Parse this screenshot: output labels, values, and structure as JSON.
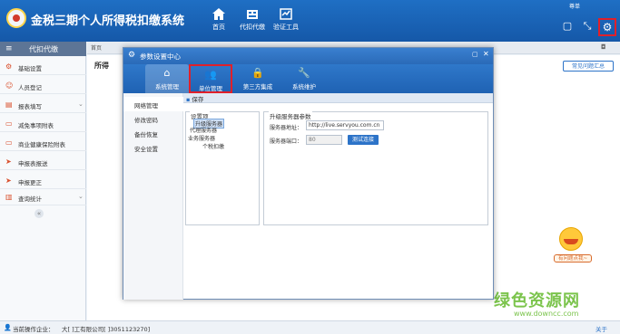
{
  "app": {
    "title": "金税三期个人所得税扣缴系统",
    "top_right_text": "尊单"
  },
  "nav": [
    {
      "label": "首页",
      "icon": "home-icon"
    },
    {
      "label": "代扣代缴",
      "icon": "briefcase-icon"
    },
    {
      "label": "验证工具",
      "icon": "tools-icon"
    }
  ],
  "sidebar": {
    "header": "代扣代缴",
    "items": [
      {
        "label": "基础设置",
        "icon": "gear-icon"
      },
      {
        "label": "人员登记",
        "icon": "person-icon"
      },
      {
        "label": "报表填写",
        "icon": "report-icon",
        "expandable": true
      },
      {
        "label": "减免事项附表",
        "icon": "document-icon"
      },
      {
        "label": "商业健康保险附表",
        "icon": "document-icon"
      },
      {
        "label": "申报表报送",
        "icon": "send-icon"
      },
      {
        "label": "申报更正",
        "icon": "send-icon"
      },
      {
        "label": "查询统计",
        "icon": "chart-icon",
        "expandable": true
      }
    ]
  },
  "main": {
    "tab_home": "首页",
    "page_title": "所得",
    "help_button": "常见问题汇总",
    "mascot_label": "有问题点我~"
  },
  "dialog": {
    "title": "参数设置中心",
    "tabs": [
      {
        "label": "系统管理",
        "icon": "house-icon"
      },
      {
        "label": "单位管理",
        "icon": "users-icon"
      },
      {
        "label": "第三方集成",
        "icon": "lock-icon"
      },
      {
        "label": "系统维护",
        "icon": "wrench-icon"
      }
    ],
    "left_nav": [
      "网络管理",
      "修改密码",
      "备份恢复",
      "安全设置"
    ],
    "save_label": "保存",
    "tree": {
      "legend": "设置项",
      "nodes": [
        "升级服务器",
        "代理服务器",
        "业务服务器",
        "个税扣缴"
      ]
    },
    "settings": {
      "legend": "升级服务器参数",
      "address_label": "服务器地址：",
      "address_value": "http://live.servyou.com.cn",
      "port_label": "服务器端口：",
      "port_value": "80",
      "test_button": "测试连接"
    }
  },
  "status": {
    "label": "当前操作企业：",
    "company": "大[         ]工有限公司[            ]3051123270]",
    "link": "关于"
  },
  "watermark": {
    "cn": "绿色资源网",
    "url": "www.downcc.com"
  },
  "colors": {
    "header": "#1f6fc4",
    "highlight": "#e0202a",
    "accent": "#2c73c8",
    "watermark": "#7bc44c"
  }
}
